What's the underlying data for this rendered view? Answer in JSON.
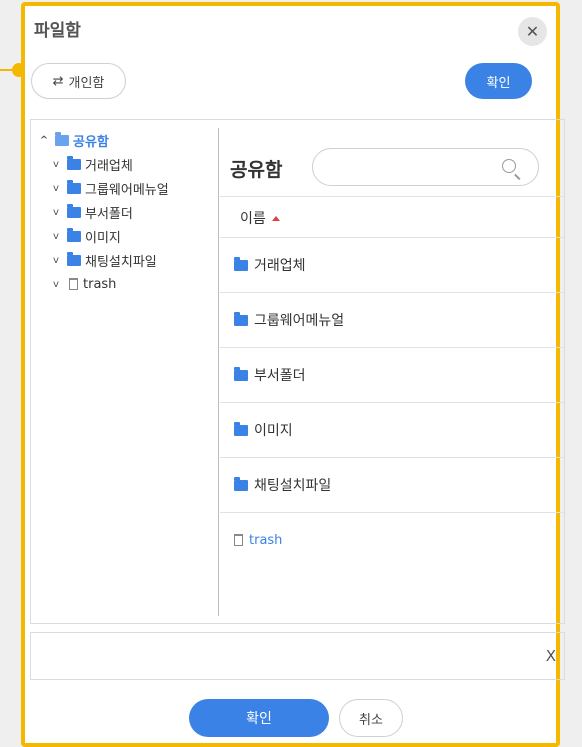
{
  "dialog": {
    "title": "파일함",
    "close_glyph": "✕",
    "personal_button": {
      "icon": "swap-icon",
      "icon_glyph": "⇄",
      "label": "개인함"
    },
    "top_confirm_label": "확인"
  },
  "tree": {
    "root": {
      "label": "공유함",
      "expanded": true
    },
    "items": [
      {
        "label": "거래업체",
        "type": "folder"
      },
      {
        "label": "그룹웨어메뉴얼",
        "type": "folder"
      },
      {
        "label": "부서폴더",
        "type": "folder"
      },
      {
        "label": "이미지",
        "type": "folder"
      },
      {
        "label": "채팅설치파일",
        "type": "folder"
      },
      {
        "label": "trash",
        "type": "trash"
      }
    ]
  },
  "main": {
    "title": "공유함",
    "search_placeholder": "",
    "column_header": "이름",
    "rows": [
      {
        "label": "거래업체",
        "type": "folder"
      },
      {
        "label": "그룹웨어메뉴얼",
        "type": "folder"
      },
      {
        "label": "부서폴더",
        "type": "folder"
      },
      {
        "label": "이미지",
        "type": "folder"
      },
      {
        "label": "채팅설치파일",
        "type": "folder"
      },
      {
        "label": "trash",
        "type": "trash"
      }
    ]
  },
  "footer": {
    "clear_label": "X",
    "confirm_label": "확인",
    "cancel_label": "취소"
  },
  "colors": {
    "accent": "#3b82e6",
    "highlight_border": "#f5b800",
    "sort_indicator": "#e04040"
  }
}
